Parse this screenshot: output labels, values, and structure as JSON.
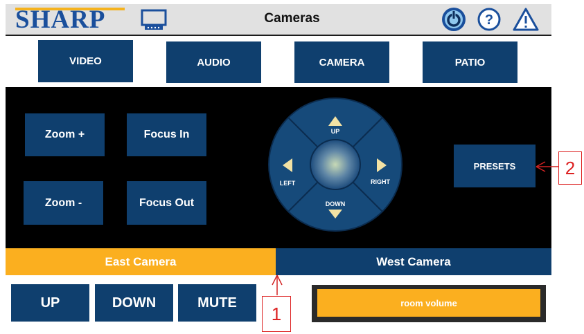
{
  "header": {
    "brand": "SHARP",
    "title": "Cameras"
  },
  "nav": {
    "tabs": [
      "VIDEO",
      "AUDIO",
      "CAMERA",
      "PATIO"
    ]
  },
  "camera_controls": {
    "zoom_in": "Zoom +",
    "zoom_out": "Zoom -",
    "focus_in": "Focus In",
    "focus_out": "Focus Out",
    "presets": "PRESETS",
    "dpad": {
      "up": "UP",
      "down": "DOWN",
      "left": "LEFT",
      "right": "RIGHT"
    }
  },
  "camera_select": {
    "east": "East Camera",
    "west": "West Camera",
    "selected": "East Camera"
  },
  "volume": {
    "up": "UP",
    "down": "DOWN",
    "mute": "MUTE",
    "label": "room volume"
  },
  "annotations": {
    "callout_1": "1",
    "callout_2": "2"
  },
  "colors": {
    "accent_blue": "#0f3f6e",
    "accent_orange": "#fbaf1f",
    "callout_red": "#d22222"
  }
}
